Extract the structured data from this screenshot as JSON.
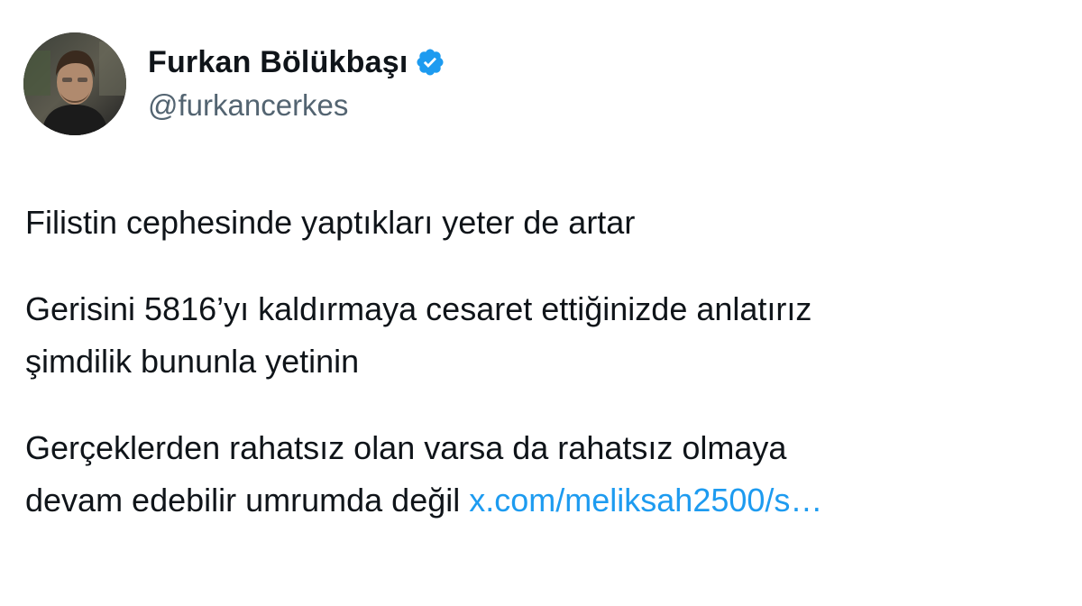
{
  "author": {
    "display_name": "Furkan Bölükbaşı",
    "handle": "@furkancerkes",
    "verified_icon": "verified-badge-icon",
    "verified_color": "#1d9bf0"
  },
  "tweet": {
    "paragraphs": [
      {
        "lines": [
          "Filistin cephesinde yaptıkları yeter de artar"
        ]
      },
      {
        "lines": [
          "Gerisini 5816’yı kaldırmaya cesaret ettiğinizde anlatırız",
          "şimdilik bununla yetinin"
        ]
      },
      {
        "lines": [
          "Gerçeklerden rahatsız olan varsa da rahatsız olmaya"
        ]
      }
    ],
    "last_line_text": "devam edebilir umrumda değil ",
    "link_text": "x.com/meliksah2500/s…",
    "link_color": "#1d9bf0"
  },
  "colors": {
    "text": "#0f1419",
    "secondary": "#536471",
    "background": "#ffffff"
  }
}
